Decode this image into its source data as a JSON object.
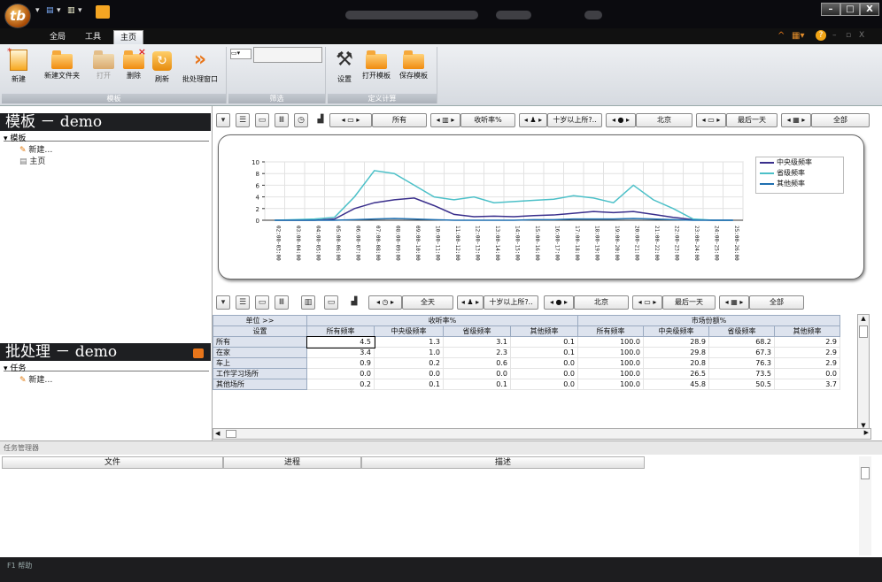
{
  "qat": {
    "items": [
      "▾",
      "▤",
      "▾",
      "▥",
      "▾"
    ]
  },
  "window": {
    "min": "–",
    "max": "□",
    "close": "X"
  },
  "tabs": [
    "全局",
    "工具",
    "主页"
  ],
  "ribbon": {
    "groups": [
      {
        "name": "模板",
        "buttons": [
          "新建",
          "新建文件夹",
          "打开",
          "删除",
          "刷新",
          "批处理窗口"
        ]
      },
      {
        "name": "筛选",
        "buttons": []
      },
      {
        "name": "定义计算",
        "buttons": [
          "设置",
          "打开模板",
          "保存模板"
        ]
      }
    ]
  },
  "left": {
    "template_title": "模板 － demo",
    "template_section": "模板",
    "template_items": [
      "新建…",
      "主页"
    ],
    "batch_title": "批处理 － demo",
    "task_section": "任务",
    "task_items": [
      "新建…"
    ]
  },
  "filters1": [
    "所有",
    "收听率%",
    "十岁以上所?..",
    "北京",
    "最后一天",
    "全部"
  ],
  "filters2": [
    "全天",
    "十岁以上所?..",
    "北京",
    "最后一天",
    "全部"
  ],
  "chart_data": {
    "type": "line",
    "x": [
      "02:00-03:00",
      "03:00-04:00",
      "04:00-05:00",
      "05:00-06:00",
      "06:00-07:00",
      "07:00-08:00",
      "08:00-09:00",
      "09:00-10:00",
      "10:00-11:00",
      "11:00-12:00",
      "12:00-13:00",
      "13:00-14:00",
      "14:00-15:00",
      "15:00-16:00",
      "16:00-17:00",
      "17:00-18:00",
      "18:00-19:00",
      "19:00-20:00",
      "20:00-21:00",
      "21:00-22:00",
      "22:00-23:00",
      "23:00-24:00",
      "24:00-25:00",
      "25:00-26:00"
    ],
    "ylim": [
      0,
      10
    ],
    "yticks": [
      "10",
      "8",
      "6",
      "4",
      "2",
      "0"
    ],
    "series": [
      {
        "name": "中央级频率",
        "color": "#3a2f8c",
        "values": [
          0,
          0,
          0,
          0.2,
          2,
          3,
          3.5,
          3.8,
          2.5,
          1,
          0.6,
          0.7,
          0.6,
          0.8,
          0.9,
          1.2,
          1.5,
          1.3,
          1.5,
          1,
          0.5,
          0.1,
          0,
          0
        ]
      },
      {
        "name": "省级频率",
        "color": "#4cc0c8",
        "values": [
          0,
          0.1,
          0.2,
          0.5,
          4,
          8.5,
          8,
          6,
          4,
          3.5,
          4,
          3,
          3.2,
          3.4,
          3.6,
          4.2,
          3.8,
          3,
          6,
          3.5,
          2,
          0.2,
          0,
          0
        ]
      },
      {
        "name": "其他频率",
        "color": "#1f6fb0",
        "values": [
          0,
          0,
          0,
          0,
          0.1,
          0.2,
          0.3,
          0.2,
          0.1,
          0,
          0,
          0,
          0,
          0.1,
          0.1,
          0.2,
          0.2,
          0.2,
          0.3,
          0.2,
          0.1,
          0,
          0,
          0
        ]
      }
    ]
  },
  "table": {
    "unit_label": "单位 >>",
    "settings_label": "设置",
    "group1": "收听率%",
    "group2": "市场份额%",
    "cols": [
      "所有频率",
      "中央级频率",
      "省级频率",
      "其他频率",
      "所有频率",
      "中央级频率",
      "省级频率",
      "其他频率"
    ],
    "rows": [
      {
        "label": "所有",
        "values": [
          "4.5",
          "1.3",
          "3.1",
          "0.1",
          "100.0",
          "28.9",
          "68.2",
          "2.9"
        ]
      },
      {
        "label": "在家",
        "values": [
          "3.4",
          "1.0",
          "2.3",
          "0.1",
          "100.0",
          "29.8",
          "67.3",
          "2.9"
        ]
      },
      {
        "label": "车上",
        "values": [
          "0.9",
          "0.2",
          "0.6",
          "0.0",
          "100.0",
          "20.8",
          "76.3",
          "2.9"
        ]
      },
      {
        "label": "工作学习场所",
        "values": [
          "0.0",
          "0.0",
          "0.0",
          "0.0",
          "100.0",
          "26.5",
          "73.5",
          "0.0"
        ]
      },
      {
        "label": "其他场所",
        "values": [
          "0.2",
          "0.1",
          "0.1",
          "0.0",
          "100.0",
          "45.8",
          "50.5",
          "3.7"
        ]
      }
    ]
  },
  "taskmgr": {
    "title": "任务管理器",
    "cols": [
      "文件",
      "进程",
      "描述"
    ]
  },
  "status": "F1 帮助"
}
